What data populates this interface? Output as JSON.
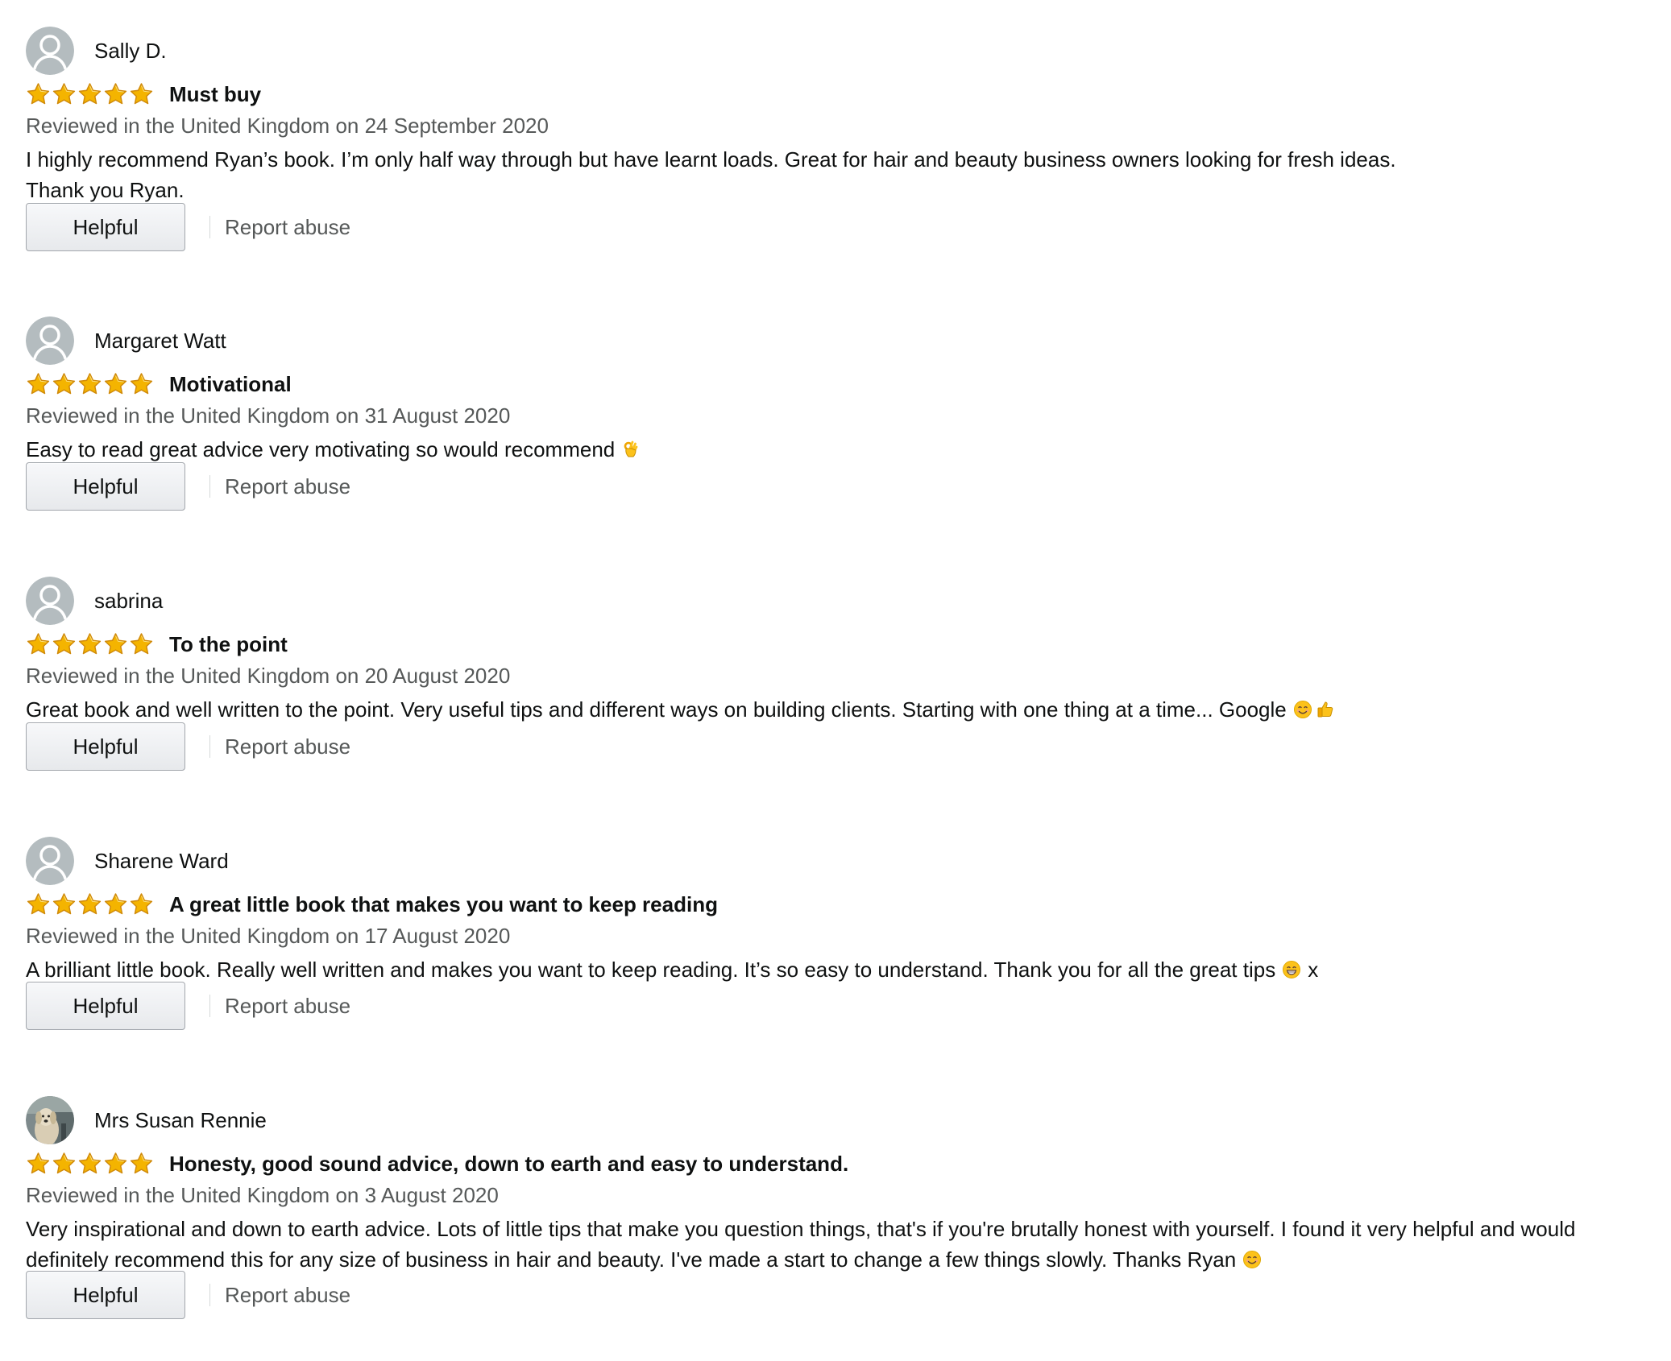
{
  "reviews": [
    {
      "name": "Sally D.",
      "avatar": "default-avatar",
      "rating": 5,
      "max_rating": 5,
      "title": "Must buy",
      "date": "Reviewed in the United Kingdom on 24 September 2020",
      "body_lines": [
        "I highly recommend Ryan’s book. I’m only half way through but have learnt loads. Great for hair and beauty business owners looking for fresh ideas.",
        "Thank you Ryan."
      ],
      "body_emoji": [],
      "body_suffix": "",
      "helpful_label": "Helpful",
      "report_label": "Report abuse"
    },
    {
      "name": "Margaret Watt",
      "avatar": "default-avatar",
      "rating": 5,
      "max_rating": 5,
      "title": "Motivational",
      "date": "Reviewed in the United Kingdom on 31 August 2020",
      "body_lines": [
        "Easy to read great advice very motivating so would recommend"
      ],
      "body_emoji": [
        "ok-hand-emoji"
      ],
      "body_suffix": "",
      "helpful_label": "Helpful",
      "report_label": "Report abuse"
    },
    {
      "name": "sabrina",
      "avatar": "default-avatar",
      "rating": 5,
      "max_rating": 5,
      "title": "To the point",
      "date": "Reviewed in the United Kingdom on 20 August 2020",
      "body_lines": [
        "Great book and well written to the point. Very useful tips and different ways on building clients. Starting with one thing at a time... Google"
      ],
      "body_emoji": [
        "smiling-face-emoji",
        "thumbs-up-emoji"
      ],
      "body_suffix": "",
      "helpful_label": "Helpful",
      "report_label": "Report abuse"
    },
    {
      "name": "Sharene Ward",
      "avatar": "default-avatar",
      "rating": 5,
      "max_rating": 5,
      "title": "A great little book that makes you want to keep reading",
      "date": "Reviewed in the United Kingdom on 17 August 2020",
      "body_lines": [
        "A brilliant little book. Really well written and makes you want to keep reading. It’s so easy to understand. Thank you for all the great tips"
      ],
      "body_emoji": [
        "grinning-face-emoji"
      ],
      "body_suffix": "x",
      "helpful_label": "Helpful",
      "report_label": "Report abuse"
    },
    {
      "name": "Mrs Susan Rennie",
      "avatar": "dog-photo-avatar",
      "rating": 5,
      "max_rating": 5,
      "title": "Honesty, good sound advice, down to earth and easy to understand.",
      "date": "Reviewed in the United Kingdom on 3 August 2020",
      "body_lines": [
        "Very inspirational and down to earth advice. Lots of little tips that make you question things, that's if you're brutally honest with yourself. I found it very helpful and would",
        "definitely recommend this for any size of business in hair and beauty. I've made a start to change a few things slowly. Thanks Ryan"
      ],
      "body_emoji": [
        "smiling-face-emoji"
      ],
      "body_suffix": "",
      "helpful_label": "Helpful",
      "report_label": "Report abuse"
    }
  ],
  "colors": {
    "star_fill": "#f4b400",
    "star_stroke": "#d08a0a",
    "date_text": "#565959",
    "body_text": "#0f1111",
    "avatar_bg": "#b4bcbf"
  }
}
